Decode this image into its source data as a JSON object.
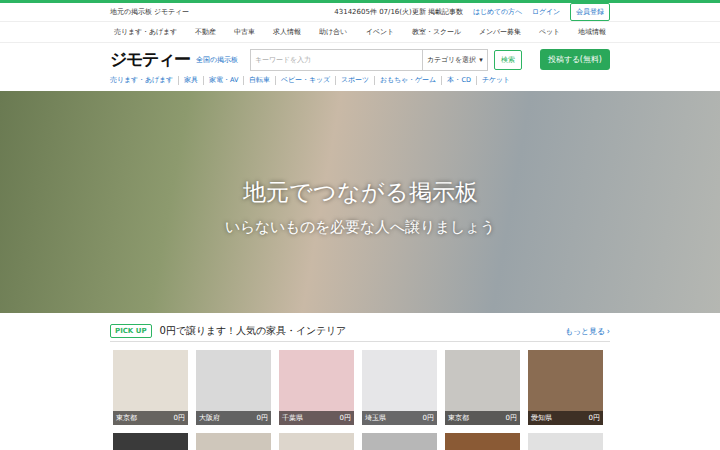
{
  "topbar": {
    "tagline": "地元の掲示板 ジモティー",
    "count": "43142605件 07/16(火)更新 掲載記事数",
    "links": [
      "はじめての方へ",
      "ログイン"
    ],
    "button": "会員登録"
  },
  "nav": [
    "売ります・あげます",
    "不動産",
    "中古車",
    "求人情報",
    "助け合い",
    "イベント",
    "教室・スクール",
    "メンバー募集",
    "ペット",
    "地域情報"
  ],
  "header": {
    "logo": "ジモティー",
    "area": "全国の掲示板",
    "search": {
      "placeholder": "キーワードを入力"
    },
    "select": {
      "label": "カテゴリを選択",
      "arrow": "▾"
    },
    "search_button": "検索",
    "post_button": "投稿する(無料)"
  },
  "subnav": [
    "売ります・あげます",
    "家具",
    "家電・AV",
    "自転車",
    "ベビー・キッズ",
    "スポーツ",
    "おもちゃ・ゲーム",
    "本・CD",
    "チケット"
  ],
  "hero": {
    "title": "地元でつながる掲示板",
    "subtitle": "いらないものを必要な人へ譲りましょう"
  },
  "pickup": {
    "badge": "PICK UP",
    "title": "0円で譲ります！人気の家具・インテリア",
    "link": "もっと見る",
    "chevron": "›",
    "items": [
      {
        "place": "東京都",
        "price": "0円"
      },
      {
        "place": "大阪府",
        "price": "0円"
      },
      {
        "place": "千葉県",
        "price": "0円"
      },
      {
        "place": "埼玉県",
        "price": "0円"
      },
      {
        "place": "東京都",
        "price": "0円"
      },
      {
        "place": "愛知県",
        "price": "0円"
      },
      {},
      {},
      {},
      {},
      {},
      {}
    ]
  }
}
